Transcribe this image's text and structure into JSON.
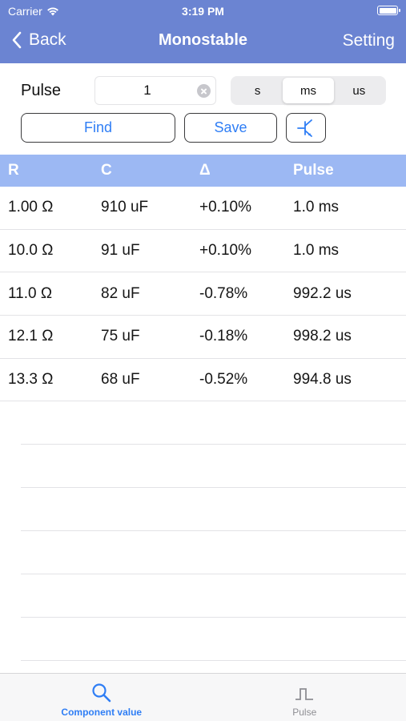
{
  "status_bar": {
    "carrier": "Carrier",
    "time": "3:19 PM"
  },
  "nav": {
    "back_label": "Back",
    "title": "Monostable",
    "setting_label": "Setting"
  },
  "controls": {
    "pulse_label": "Pulse",
    "pulse_value": "1",
    "units": [
      "s",
      "ms",
      "us"
    ],
    "selected_unit": "ms",
    "find_label": "Find",
    "save_label": "Save",
    "transistor_icon": "transistor-symbol-icon"
  },
  "table": {
    "headers": [
      "R",
      "C",
      "Δ",
      "Pulse"
    ],
    "rows": [
      [
        "1.00 Ω",
        "910 uF",
        "+0.10%",
        "1.0 ms"
      ],
      [
        "10.0 Ω",
        "91 uF",
        "+0.10%",
        "1.0 ms"
      ],
      [
        "11.0 Ω",
        "82 uF",
        "-0.78%",
        "992.2 us"
      ],
      [
        "12.1 Ω",
        "75 uF",
        "-0.18%",
        "998.2 us"
      ],
      [
        "13.3 Ω",
        "68 uF",
        "-0.52%",
        "994.8 us"
      ]
    ]
  },
  "tabbar": {
    "tabs": [
      {
        "label": "Component value",
        "icon": "search-icon",
        "active": true
      },
      {
        "label": "Pulse",
        "icon": "pulse-waveform-icon",
        "active": false
      }
    ]
  },
  "colors": {
    "nav_background": "#6b84d2",
    "table_header_background": "#9cb8f3",
    "accent": "#2f7ef5",
    "inactive_tab": "#8e8e93"
  }
}
